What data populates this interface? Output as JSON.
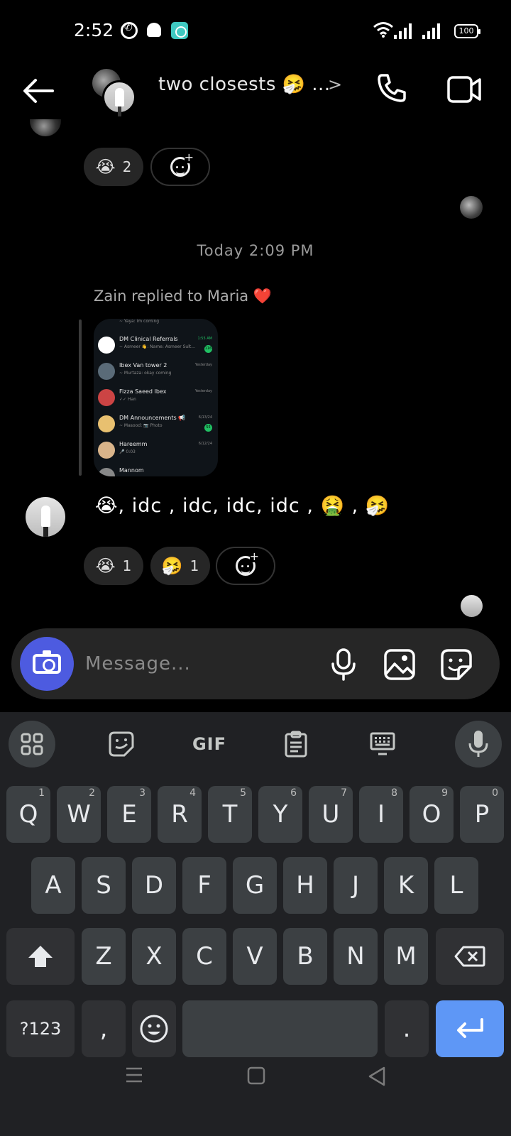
{
  "status_bar": {
    "time": "2:52",
    "battery": "100",
    "icons": [
      "whatsapp-icon",
      "snapchat-icon",
      "app-icon",
      "wifi-icon",
      "signal-icon",
      "signal-icon",
      "battery-icon"
    ]
  },
  "header": {
    "title": "two closests 🤧 ...",
    "icons": [
      "back-arrow-icon",
      "chevron-right-icon",
      "phone-icon",
      "video-camera-icon"
    ]
  },
  "chat": {
    "top_reactions": [
      {
        "emoji": "😭",
        "count": "2"
      }
    ],
    "timestamp": "Today 2:09 PM",
    "reply_label": "Zain replied to Maria ❤️",
    "shared_screenshot": {
      "rows": [
        {
          "name": "DM Clinical Referrals",
          "sub": "~ Asmeer 👋: Name: Asmeer Sult...",
          "time": "1:55 AM",
          "badge": "116"
        },
        {
          "name": "Ibex Van tower 2",
          "sub": "~ Murtaza: okay coming",
          "time": "Yesterday",
          "badge": ""
        },
        {
          "name": "Fizza Saeed Ibex",
          "sub": "✓✓ Han",
          "time": "Yesterday",
          "badge": ""
        },
        {
          "name": "DM Announcements 📢",
          "sub": "~ Masood: 📷 Photo",
          "time": "6/13/24",
          "badge": "55"
        },
        {
          "name": "Hareemm",
          "sub": "🎤 0:03",
          "time": "6/12/24",
          "badge": ""
        },
        {
          "name": "Mannom",
          "sub": "",
          "time": "",
          "badge": ""
        }
      ],
      "top_snippet": "~ Yaya: im coming"
    },
    "message_text": "😭, idc , idc, idc, idc , 🤮 , 🤧",
    "message_reactions": [
      {
        "emoji": "😭",
        "count": "1"
      },
      {
        "emoji": "🤧",
        "count": "1"
      }
    ]
  },
  "composer": {
    "placeholder": "Message...",
    "icons": [
      "camera-icon",
      "microphone-icon",
      "gallery-icon",
      "sticker-icon"
    ]
  },
  "keyboard": {
    "toolbar": {
      "gif_label": "GIF"
    },
    "row1": [
      {
        "k": "Q",
        "h": "1"
      },
      {
        "k": "W",
        "h": "2"
      },
      {
        "k": "E",
        "h": "3"
      },
      {
        "k": "R",
        "h": "4"
      },
      {
        "k": "T",
        "h": "5"
      },
      {
        "k": "Y",
        "h": "6"
      },
      {
        "k": "U",
        "h": "7"
      },
      {
        "k": "I",
        "h": "8"
      },
      {
        "k": "O",
        "h": "9"
      },
      {
        "k": "P",
        "h": "0"
      }
    ],
    "row2": [
      "A",
      "S",
      "D",
      "F",
      "G",
      "H",
      "J",
      "K",
      "L"
    ],
    "row3": [
      "Z",
      "X",
      "C",
      "V",
      "B",
      "N",
      "M"
    ],
    "symbols_label": "?123",
    "comma_label": ",",
    "period_label": "."
  }
}
